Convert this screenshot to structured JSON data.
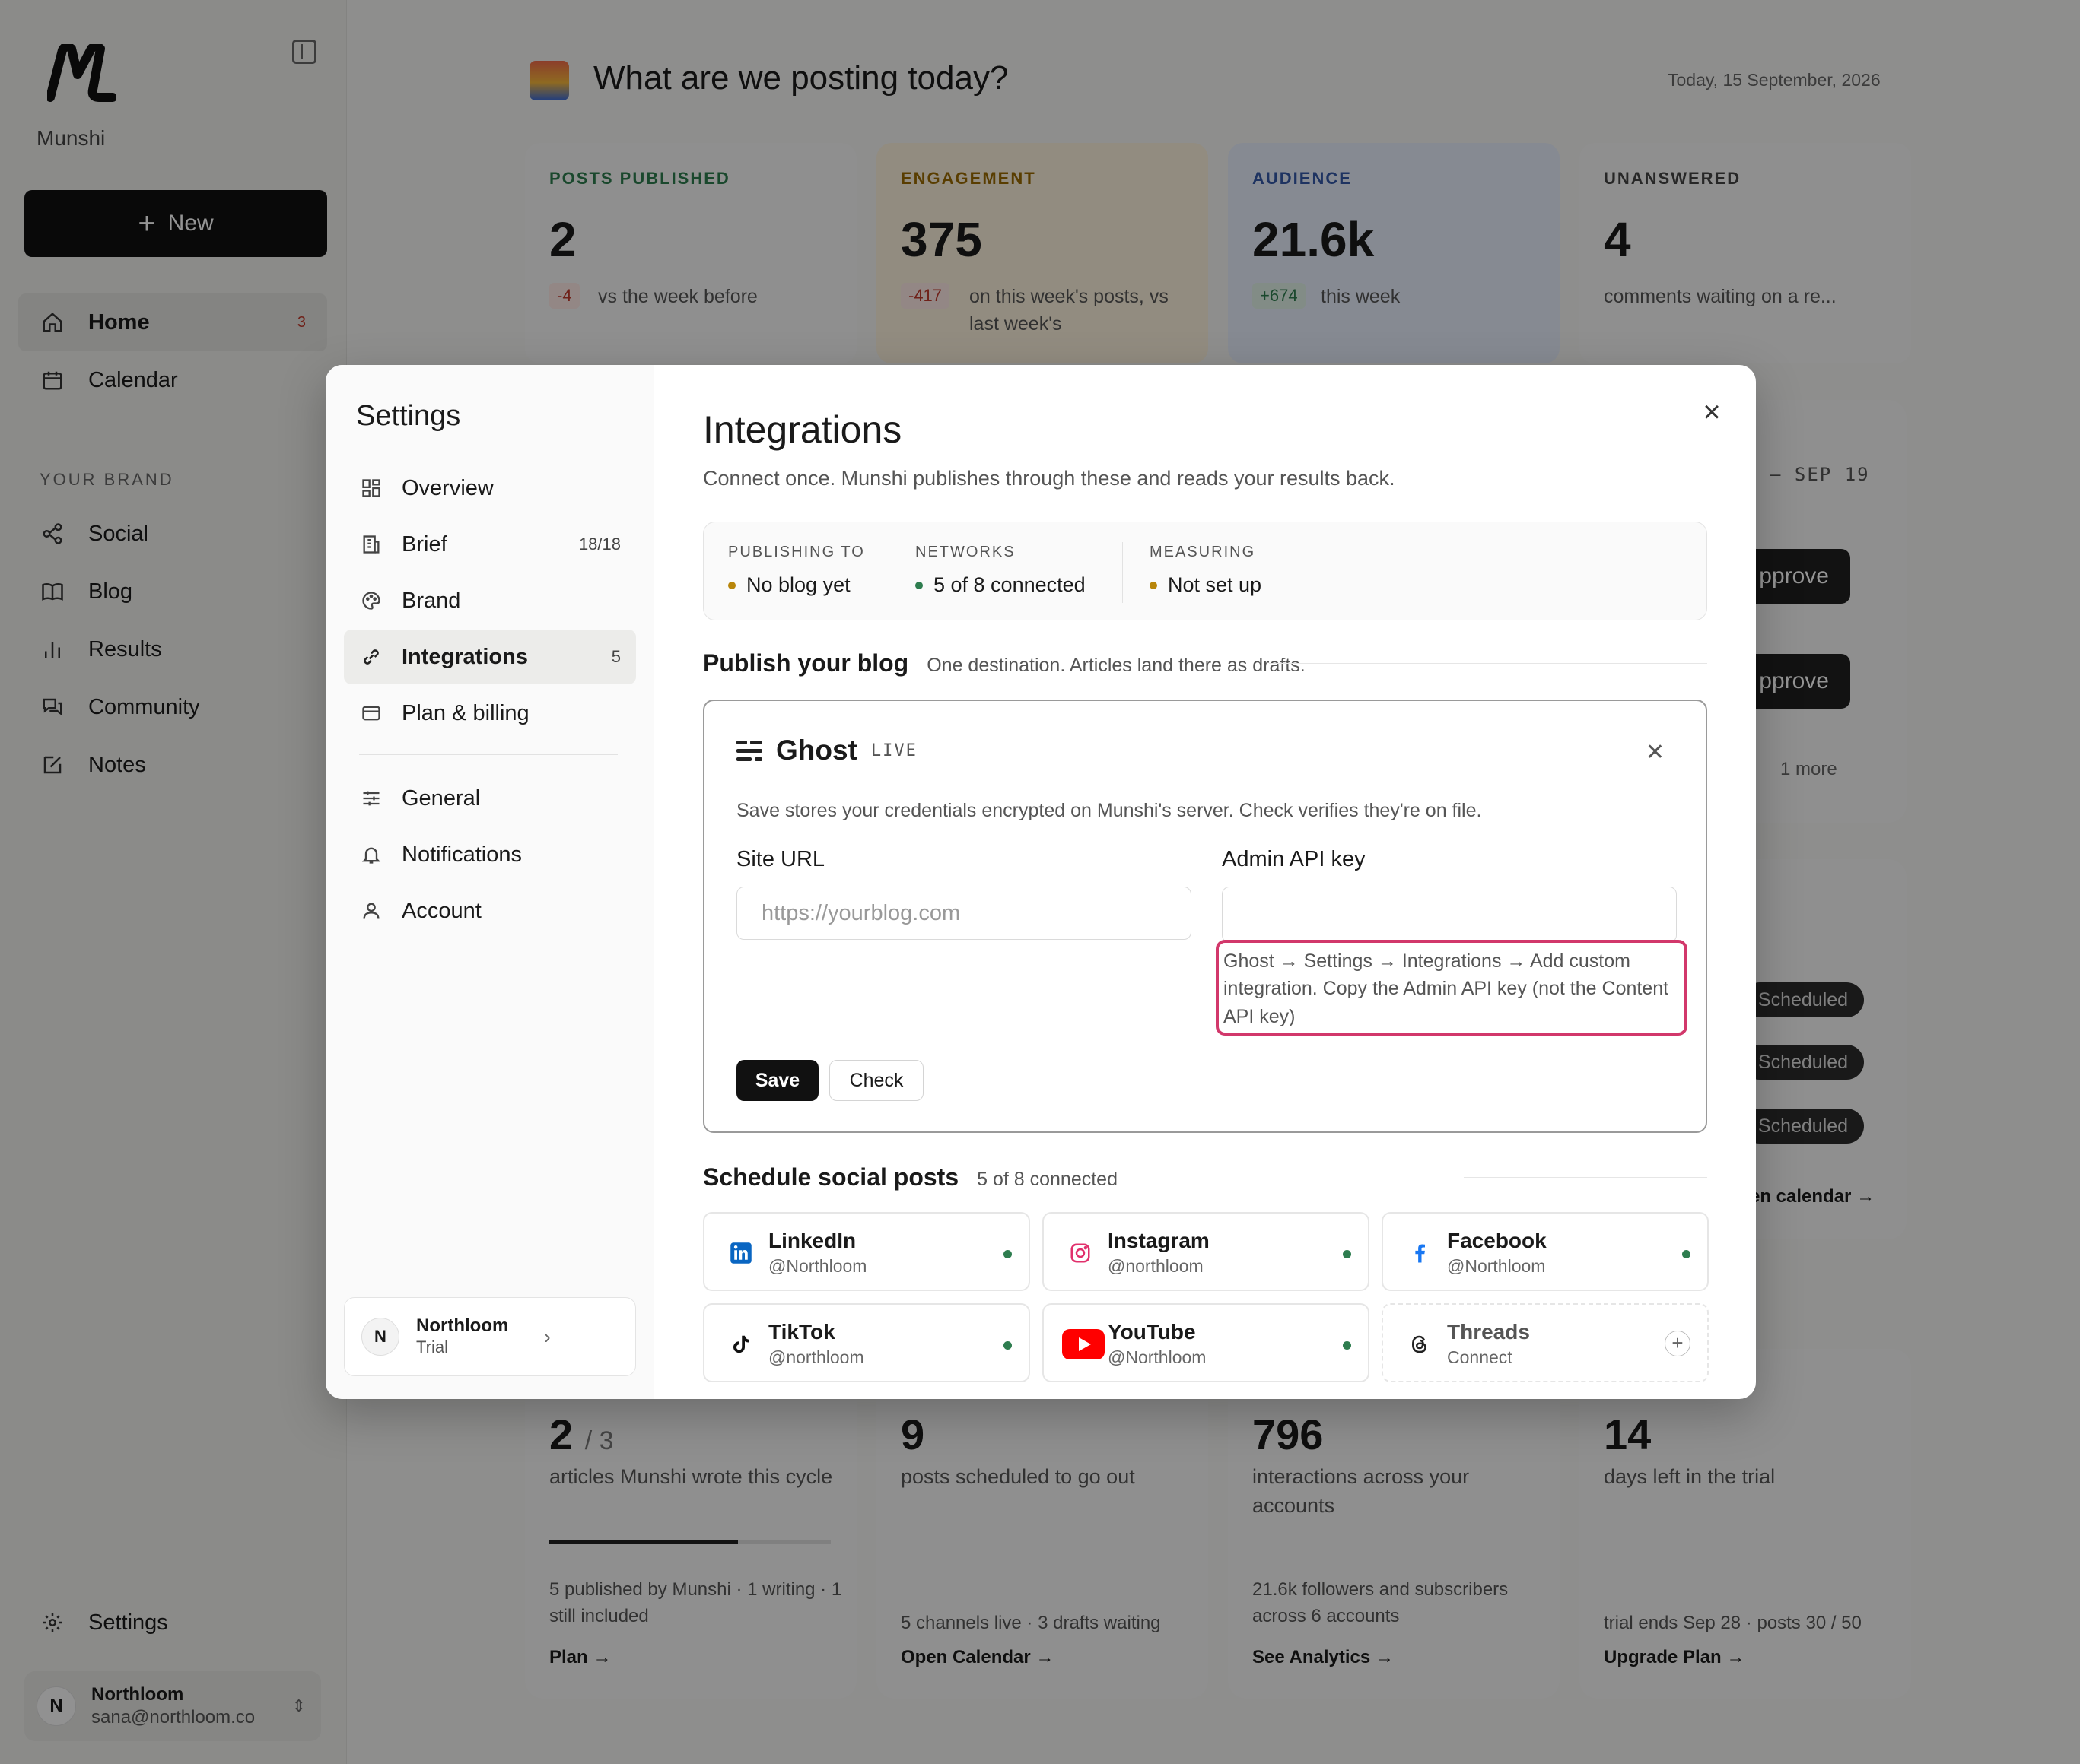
{
  "app": {
    "brand": "Munshi",
    "new_label": "New",
    "nav": [
      {
        "label": "Home",
        "count": "3"
      },
      {
        "label": "Calendar"
      },
      {
        "label": "Social"
      },
      {
        "label": "Blog"
      },
      {
        "label": "Results"
      },
      {
        "label": "Community"
      },
      {
        "label": "Notes"
      },
      {
        "label": "Settings"
      }
    ],
    "section_label": "YOUR BRAND",
    "user": {
      "initial": "N",
      "name": "Northloom",
      "email": "sana@northloom.co"
    }
  },
  "dashboard": {
    "title": "What are we posting today?",
    "date": "Today, 15 September, 2026",
    "stats": [
      {
        "label": "POSTS PUBLISHED",
        "value": "2",
        "delta": "-4",
        "note": "vs the week before"
      },
      {
        "label": "ENGAGEMENT",
        "value": "375",
        "delta": "-417",
        "note": "on this week's posts, vs last week's"
      },
      {
        "label": "AUDIENCE",
        "value": "21.6k",
        "delta": "+674",
        "note": "this week"
      },
      {
        "label": "UNANSWERED",
        "value": "4",
        "note": "comments waiting on a re..."
      }
    ],
    "right_panel": {
      "date_range": "– SEP 19",
      "approve_label": "pprove",
      "more": "1 more",
      "scheduled_label": "Scheduled",
      "calendar_link": "en calendar →"
    },
    "bottom": [
      {
        "value": "2",
        "value_total": "/ 3",
        "desc": "articles Munshi wrote this cycle",
        "sub": "5 published by Munshi · 1 writing · 1 still included",
        "link": "Plan →",
        "progress": 0.67
      },
      {
        "value": "9",
        "desc": "posts scheduled to go out",
        "sub": "5 channels live · 3 drafts waiting",
        "link": "Open Calendar →"
      },
      {
        "value": "796",
        "desc": "interactions across your accounts",
        "sub": "21.6k followers and subscribers across 6 accounts",
        "link": "See Analytics →"
      },
      {
        "value": "14",
        "desc": "days left in the trial",
        "sub": "trial ends Sep 28 · posts 30 / 50",
        "link": "Upgrade Plan →"
      }
    ]
  },
  "settings": {
    "title": "Settings",
    "nav": [
      {
        "label": "Overview"
      },
      {
        "label": "Brief",
        "count": "18/18"
      },
      {
        "label": "Brand"
      },
      {
        "label": "Integrations",
        "count": "5"
      },
      {
        "label": "Plan & billing"
      },
      {
        "label": "General"
      },
      {
        "label": "Notifications"
      },
      {
        "label": "Account"
      }
    ],
    "org": {
      "initial": "N",
      "name": "Northloom",
      "plan": "Trial"
    }
  },
  "integrations": {
    "title": "Integrations",
    "subtitle": "Connect once. Munshi publishes through these and reads your results back.",
    "status": [
      {
        "key": "PUBLISHING TO",
        "value": "No blog yet",
        "color": "#b8860b"
      },
      {
        "key": "NETWORKS",
        "value": "5 of 8 connected",
        "color": "#2e7d4f"
      },
      {
        "key": "MEASURING",
        "value": "Not set up",
        "color": "#b8860b"
      }
    ],
    "blog_section": {
      "title": "Publish your blog",
      "subtitle": "One destination. Articles land there as drafts."
    },
    "ghost": {
      "name": "Ghost",
      "tag": "LIVE",
      "note": "Save stores your credentials encrypted on Munshi's server. Check verifies they're on file.",
      "site_url_label": "Site URL",
      "site_url_placeholder": "https://yourblog.com",
      "site_url_value": "",
      "api_key_label": "Admin API key",
      "api_key_value": "",
      "api_key_hint": "Ghost → Settings → Integrations → Add custom integration. Copy the Admin API key (not the Content API key)",
      "save_label": "Save",
      "check_label": "Check"
    },
    "social_section": {
      "title": "Schedule social posts",
      "subtitle": "5 of 8 connected"
    },
    "networks": [
      {
        "name": "LinkedIn",
        "handle": "@Northloom",
        "icon": "linkedin-icon",
        "connected": true
      },
      {
        "name": "Instagram",
        "handle": "@northloom",
        "icon": "instagram-icon",
        "connected": true
      },
      {
        "name": "Facebook",
        "handle": "@Northloom",
        "icon": "facebook-icon",
        "connected": true
      },
      {
        "name": "TikTok",
        "handle": "@northloom",
        "icon": "tiktok-icon",
        "connected": true
      },
      {
        "name": "YouTube",
        "handle": "@Northloom",
        "icon": "youtube-icon",
        "connected": true
      },
      {
        "name": "Threads",
        "handle": "Connect",
        "icon": "threads-icon",
        "connected": false
      }
    ],
    "colors": {
      "accent_hint": "#d2386b",
      "connected": "#2e7d4f",
      "pending": "#b8860b"
    }
  }
}
